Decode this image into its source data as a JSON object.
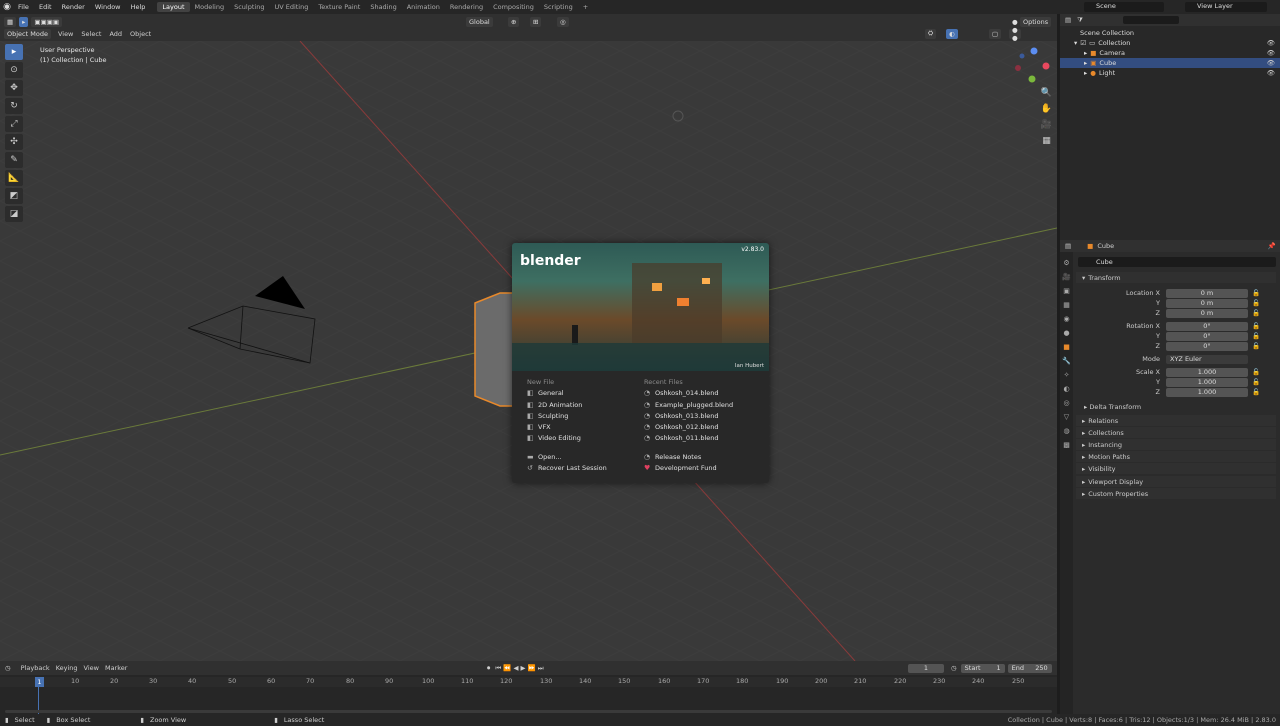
{
  "menu": [
    "File",
    "Edit",
    "Render",
    "Window",
    "Help"
  ],
  "workspaces": [
    "Layout",
    "Modeling",
    "Sculpting",
    "UV Editing",
    "Texture Paint",
    "Shading",
    "Animation",
    "Rendering",
    "Compositing",
    "Scripting"
  ],
  "add_tab": "+",
  "scene": "Scene",
  "view_layer": "View Layer",
  "viewport_header": {
    "mode": "Object Mode",
    "menus": [
      "View",
      "Select",
      "Add",
      "Object"
    ],
    "orientation": "Global",
    "options": "Options"
  },
  "viewport": {
    "view_name": "User Perspective",
    "context": "(1) Collection | Cube"
  },
  "splash": {
    "version": "v2.83.0",
    "logo": "blender",
    "credit": "Ian Hubert",
    "new_file_header": "New File",
    "new_file": [
      "General",
      "2D Animation",
      "Sculpting",
      "VFX",
      "Video Editing"
    ],
    "recent_header": "Recent Files",
    "recent": [
      "Oshkosh_014.blend",
      "Example_plugged.blend",
      "Oshkosh_013.blend",
      "Oshkosh_012.blend",
      "Oshkosh_011.blend"
    ],
    "open": "Open...",
    "recover": "Recover Last Session",
    "release_notes": "Release Notes",
    "dev_fund": "Development Fund"
  },
  "outliner": {
    "root": "Scene Collection",
    "collection": "Collection",
    "items": [
      "Camera",
      "Cube",
      "Light"
    ]
  },
  "properties": {
    "object": "Cube",
    "name_field": "Cube",
    "transform": "Transform",
    "location_label": "Location X",
    "y": "Y",
    "z": "Z",
    "location": [
      "0 m",
      "0 m",
      "0 m"
    ],
    "rotation_label": "Rotation X",
    "rotation": [
      "0°",
      "0°",
      "0°"
    ],
    "mode_label": "Mode",
    "mode": "XYZ Euler",
    "scale_label": "Scale X",
    "scale": [
      "1.000",
      "1.000",
      "1.000"
    ],
    "delta": "Delta Transform",
    "sections": [
      "Relations",
      "Collections",
      "Instancing",
      "Motion Paths",
      "Visibility",
      "Viewport Display",
      "Custom Properties"
    ]
  },
  "timeline": {
    "menus": [
      "Playback",
      "Keying",
      "View",
      "Marker"
    ],
    "current_frame": "1",
    "start_label": "Start",
    "start": "1",
    "end_label": "End",
    "end": "250",
    "ticks": [
      "1",
      "10",
      "20",
      "30",
      "40",
      "50",
      "60",
      "70",
      "80",
      "90",
      "100",
      "110",
      "120",
      "130",
      "140",
      "150",
      "160",
      "170",
      "180",
      "190",
      "200",
      "210",
      "220",
      "230",
      "240",
      "250"
    ]
  },
  "status": {
    "select": "Select",
    "box_select": "Box Select",
    "zoom_view": "Zoom View",
    "lasso": "Lasso Select",
    "stats": "Collection | Cube | Verts:8 | Faces:6 | Tris:12 | Objects:1/3 | Mem: 26.4 MiB | 2.83.0"
  }
}
